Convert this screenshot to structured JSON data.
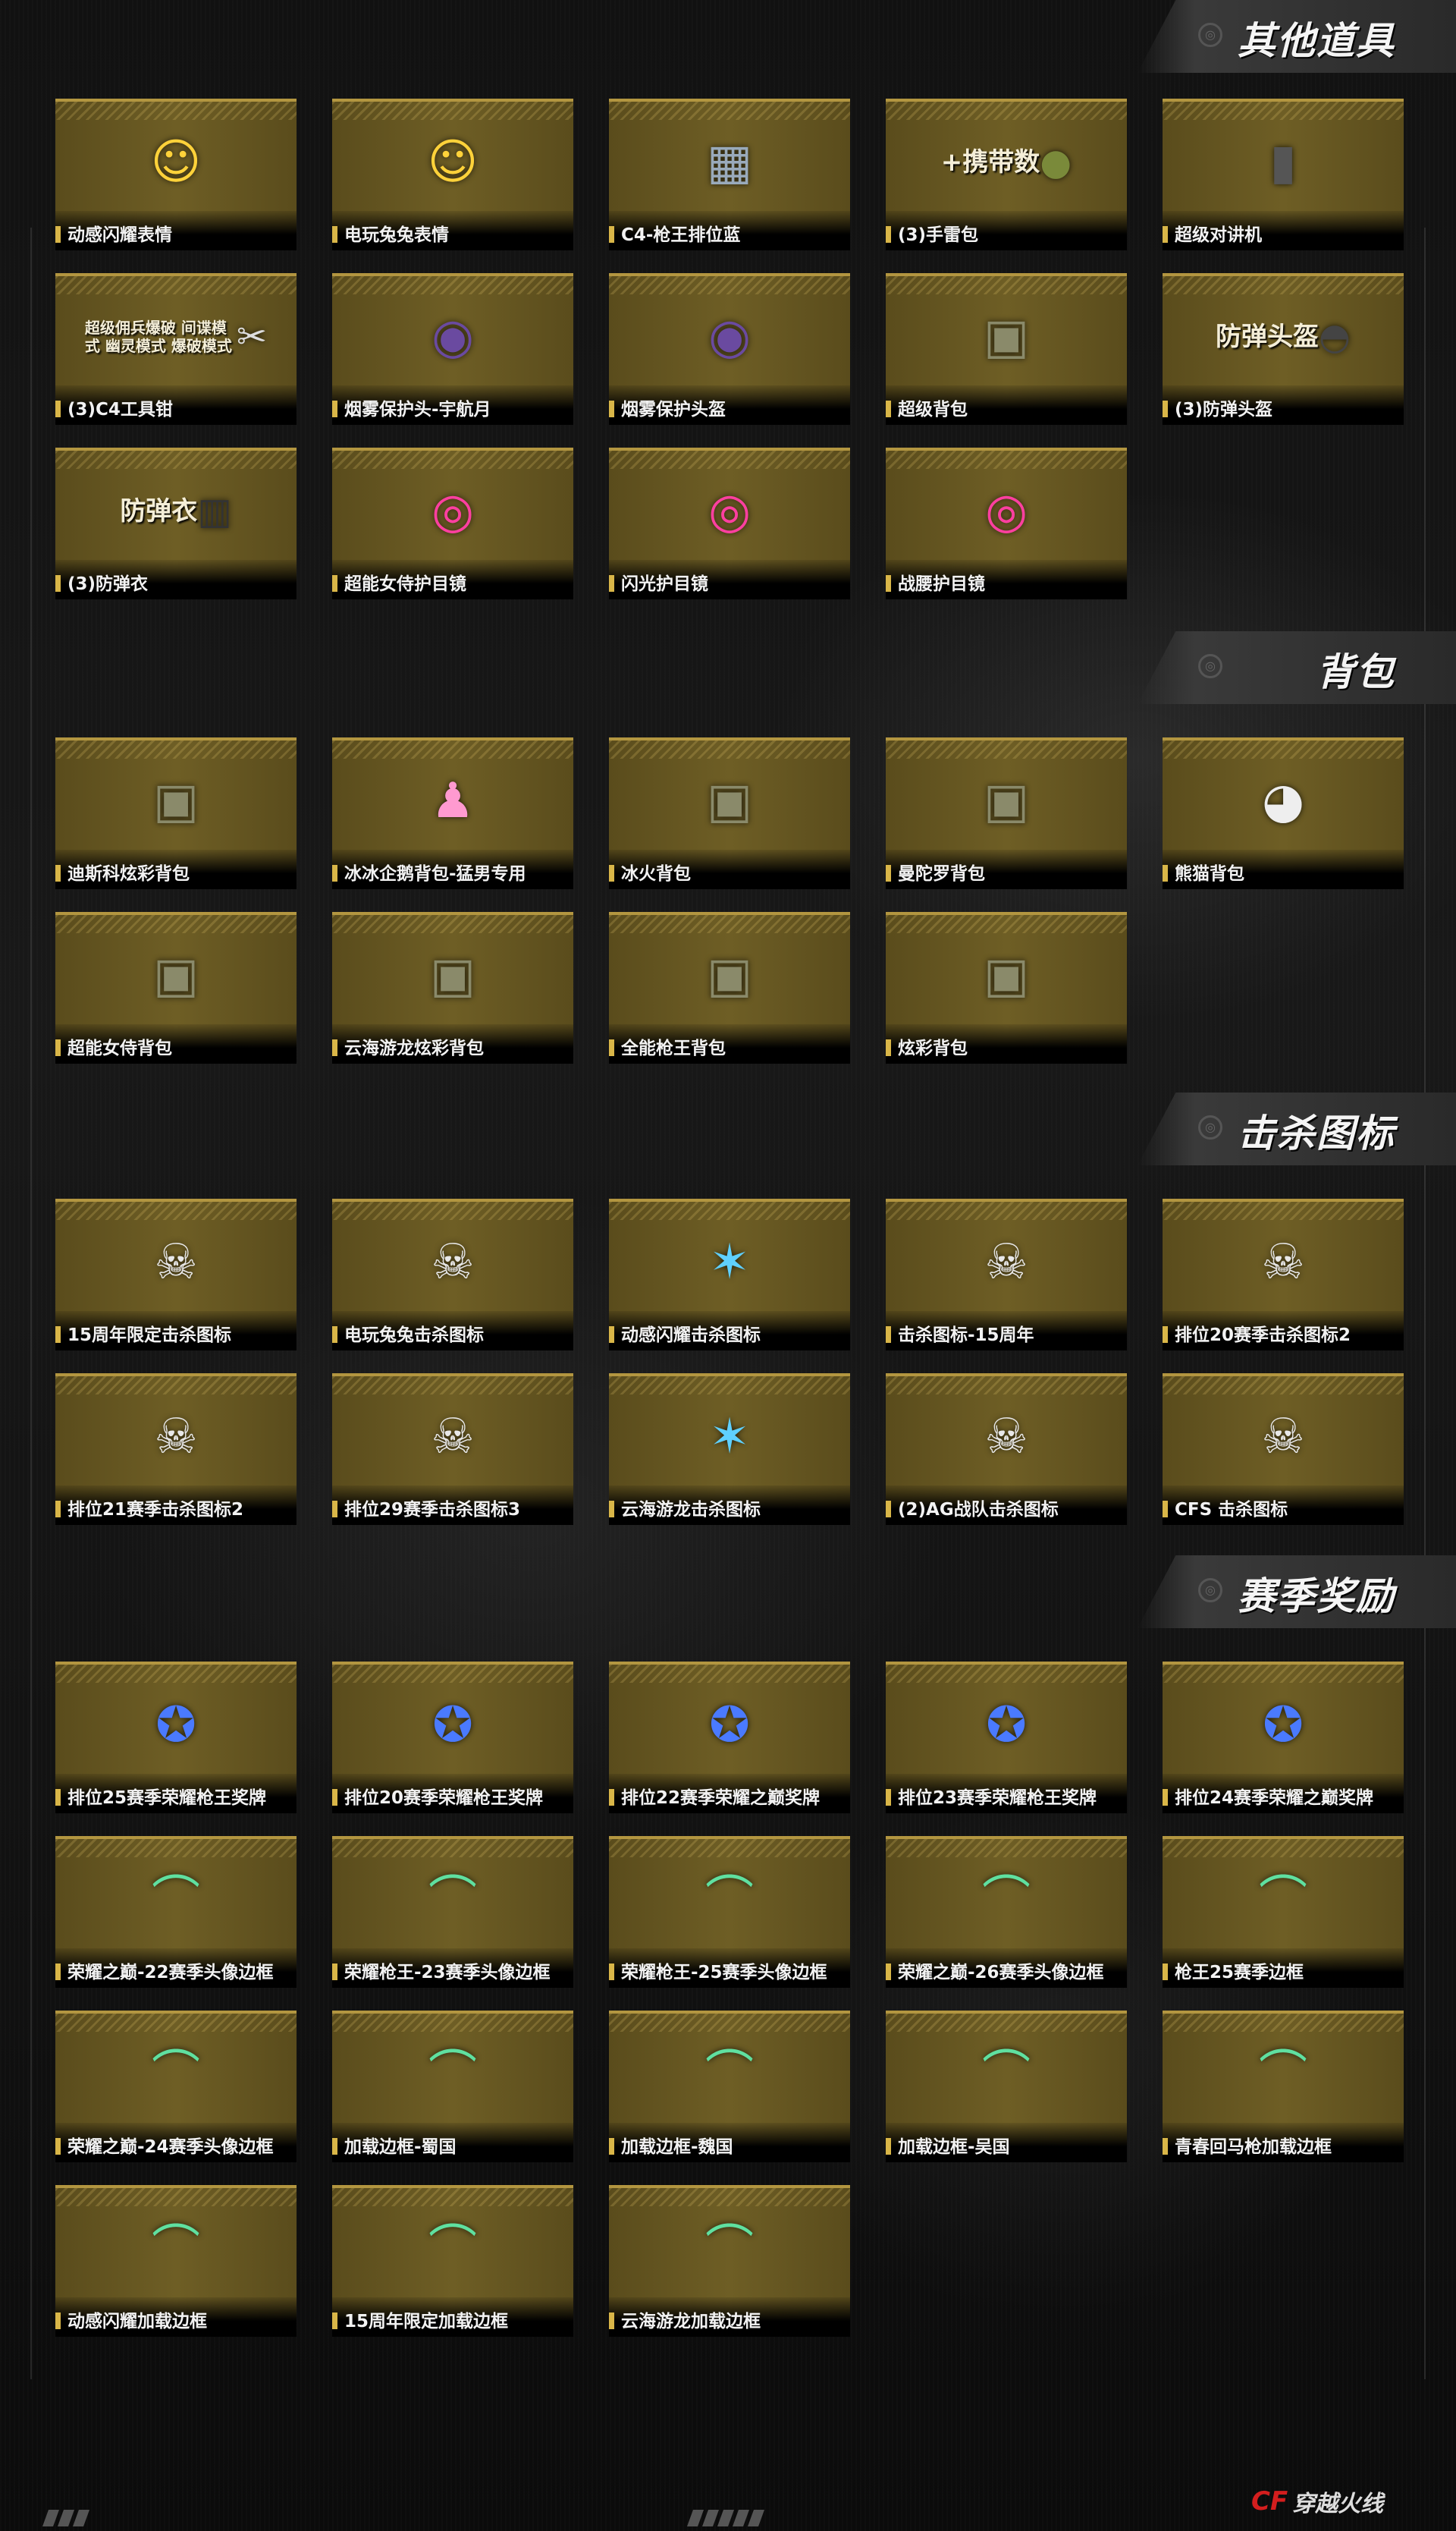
{
  "colors": {
    "accent": "#d9b648",
    "card": "#6e5e25",
    "background": "#0c0c0c"
  },
  "sections": [
    {
      "title": "其他道具",
      "items": [
        {
          "label": "动感闪耀表情",
          "icon": "emoji-icon"
        },
        {
          "label": "电玩兔兔表情",
          "icon": "emoji-icon"
        },
        {
          "label": "C4-枪王排位蓝",
          "icon": "c4-bomb-icon"
        },
        {
          "label": "(3)手雷包",
          "icon": "grenade-icon",
          "art_text": "+携带数"
        },
        {
          "label": "超级对讲机",
          "icon": "walkie-talkie-icon"
        },
        {
          "label": "(3)C4工具钳",
          "icon": "pliers-icon",
          "art_text": "超级佣兵爆破 间谍模式 幽灵模式 爆破模式"
        },
        {
          "label": "烟雾保护头-宇航月",
          "icon": "gas-mask-icon"
        },
        {
          "label": "烟雾保护头盔",
          "icon": "gas-mask-icon"
        },
        {
          "label": "超级背包",
          "icon": "backpack-icon"
        },
        {
          "label": "(3)防弹头盔",
          "icon": "helmet-icon",
          "art_text": "防弹头盔"
        },
        {
          "label": "(3)防弹衣",
          "icon": "vest-icon",
          "art_text": "防弹衣"
        },
        {
          "label": "超能女侍护目镜",
          "icon": "goggles-icon"
        },
        {
          "label": "闪光护目镜",
          "icon": "goggles-icon"
        },
        {
          "label": "战腰护目镜",
          "icon": "goggles-icon"
        }
      ]
    },
    {
      "title": "背包",
      "items": [
        {
          "label": "迪斯科炫彩背包",
          "icon": "backpack-icon"
        },
        {
          "label": "冰冰企鹅背包-猛男专用",
          "icon": "penguin-icon"
        },
        {
          "label": "冰火背包",
          "icon": "backpack-icon"
        },
        {
          "label": "曼陀罗背包",
          "icon": "backpack-icon"
        },
        {
          "label": "熊猫背包",
          "icon": "panda-icon"
        },
        {
          "label": "超能女侍背包",
          "icon": "backpack-icon"
        },
        {
          "label": "云海游龙炫彩背包",
          "icon": "backpack-icon"
        },
        {
          "label": "全能枪王背包",
          "icon": "backpack-icon"
        },
        {
          "label": "炫彩背包",
          "icon": "backpack-icon"
        }
      ]
    },
    {
      "title": "击杀图标",
      "items": [
        {
          "label": "15周年限定击杀图标",
          "icon": "skull-emblem-icon"
        },
        {
          "label": "电玩兔兔击杀图标",
          "icon": "skull-emblem-icon"
        },
        {
          "label": "动感闪耀击杀图标",
          "icon": "star-emblem-icon"
        },
        {
          "label": "击杀图标-15周年",
          "icon": "skull-emblem-icon"
        },
        {
          "label": "排位20赛季击杀图标2",
          "icon": "skull-emblem-icon"
        },
        {
          "label": "排位21赛季击杀图标2",
          "icon": "skull-emblem-icon"
        },
        {
          "label": "排位29赛季击杀图标3",
          "icon": "skull-emblem-icon"
        },
        {
          "label": "云海游龙击杀图标",
          "icon": "star-emblem-icon"
        },
        {
          "label": "(2)AG战队击杀图标",
          "icon": "skull-emblem-icon"
        },
        {
          "label": "CFS 击杀图标",
          "icon": "skull-emblem-icon"
        }
      ]
    },
    {
      "title": "赛季奖励",
      "items": [
        {
          "label": "排位25赛季荣耀枪王奖牌",
          "icon": "medal-icon"
        },
        {
          "label": "排位20赛季荣耀枪王奖牌",
          "icon": "medal-icon"
        },
        {
          "label": "排位22赛季荣耀之巅奖牌",
          "icon": "medal-icon"
        },
        {
          "label": "排位23赛季荣耀枪王奖牌",
          "icon": "medal-icon"
        },
        {
          "label": "排位24赛季荣耀之巅奖牌",
          "icon": "medal-icon"
        },
        {
          "label": "荣耀之巅-22赛季头像边框",
          "icon": "frame-icon"
        },
        {
          "label": "荣耀枪王-23赛季头像边框",
          "icon": "frame-icon"
        },
        {
          "label": "荣耀枪王-25赛季头像边框",
          "icon": "frame-icon"
        },
        {
          "label": "荣耀之巅-26赛季头像边框",
          "icon": "frame-icon"
        },
        {
          "label": "枪王25赛季边框",
          "icon": "frame-icon"
        },
        {
          "label": "荣耀之巅-24赛季头像边框",
          "icon": "frame-icon"
        },
        {
          "label": "加载边框-蜀国",
          "icon": "frame-icon"
        },
        {
          "label": "加载边框-魏国",
          "icon": "frame-icon"
        },
        {
          "label": "加载边框-吴国",
          "icon": "frame-icon"
        },
        {
          "label": "青春回马枪加载边框",
          "icon": "frame-icon"
        },
        {
          "label": "动感闪耀加载边框",
          "icon": "frame-icon"
        },
        {
          "label": "15周年限定加载边框",
          "icon": "frame-icon"
        },
        {
          "label": "云海游龙加载边框",
          "icon": "frame-icon"
        }
      ]
    }
  ],
  "footer": {
    "logo_text": "穿越火线",
    "logo_mark": "CF"
  }
}
